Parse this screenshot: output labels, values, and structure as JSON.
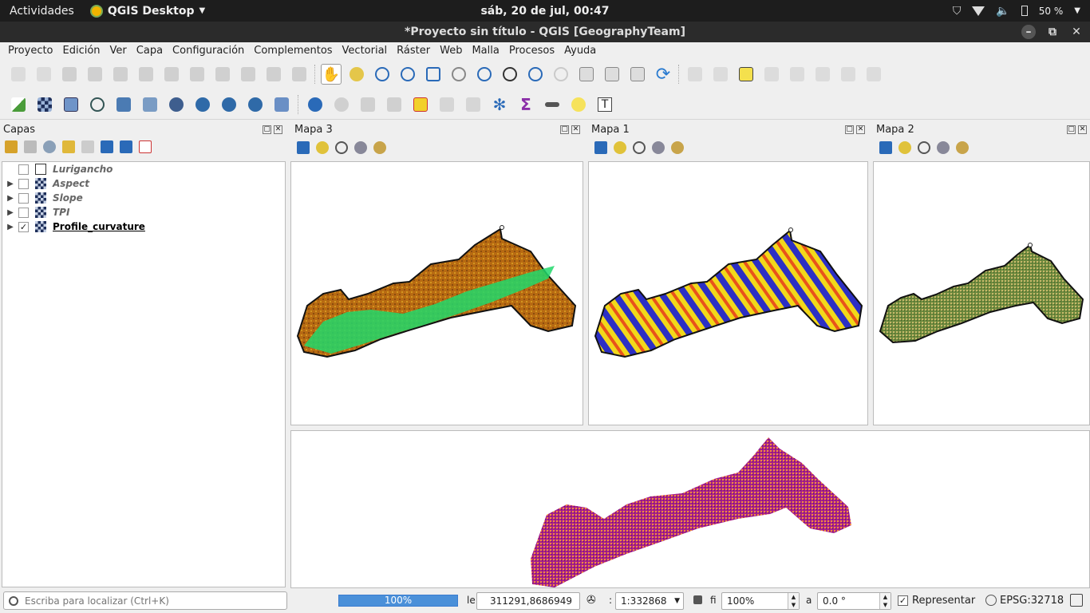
{
  "topbar": {
    "activities": "Actividades",
    "app_name": "QGIS Desktop",
    "clock": "sáb, 20 de jul, 00:47",
    "battery": "50 %"
  },
  "window": {
    "title": "*Proyecto sin título - QGIS [GeographyTeam]"
  },
  "menu": [
    "Proyecto",
    "Edición",
    "Ver",
    "Capa",
    "Configuración",
    "Complementos",
    "Vectorial",
    "Ráster",
    "Web",
    "Malla",
    "Procesos",
    "Ayuda"
  ],
  "layers_panel": {
    "title": "Capas",
    "layers": [
      {
        "name": "Lurigancho",
        "checked": false,
        "type": "vector"
      },
      {
        "name": "Aspect",
        "checked": false,
        "type": "raster"
      },
      {
        "name": "Slope",
        "checked": false,
        "type": "raster"
      },
      {
        "name": "TPI",
        "checked": false,
        "type": "raster"
      },
      {
        "name": "Profile_curvature",
        "checked": true,
        "type": "raster"
      }
    ]
  },
  "maps": {
    "map3": {
      "title": "Mapa 3"
    },
    "map1": {
      "title": "Mapa 1"
    },
    "map2": {
      "title": "Mapa 2"
    }
  },
  "status": {
    "search_placeholder": "Escriba para localizar (Ctrl+K)",
    "progress": "100%",
    "coord_label": "le",
    "coordinate": "311291,8686949",
    "scale_label": ":",
    "scale": "1:332868",
    "magnifier_label": "fi",
    "magnifier": "100%",
    "rotation_label": "a",
    "rotation": "0.0 °",
    "render_label": "Representar",
    "render_checked": "✓",
    "crs": "EPSG:32718"
  },
  "colors": {
    "topbar_bg": "#1d1d1d",
    "titlebar_bg": "#2b2b2b",
    "progress": "#4a90d9",
    "map3": [
      "#b76a12",
      "#21d86b"
    ],
    "map1": [
      "#f2d81a",
      "#2c2fc4",
      "#e8531b"
    ],
    "map2": [
      "#6d8a3e",
      "#c9b86b"
    ],
    "bottom_map": [
      "#a8208a",
      "#f28f3b"
    ]
  }
}
